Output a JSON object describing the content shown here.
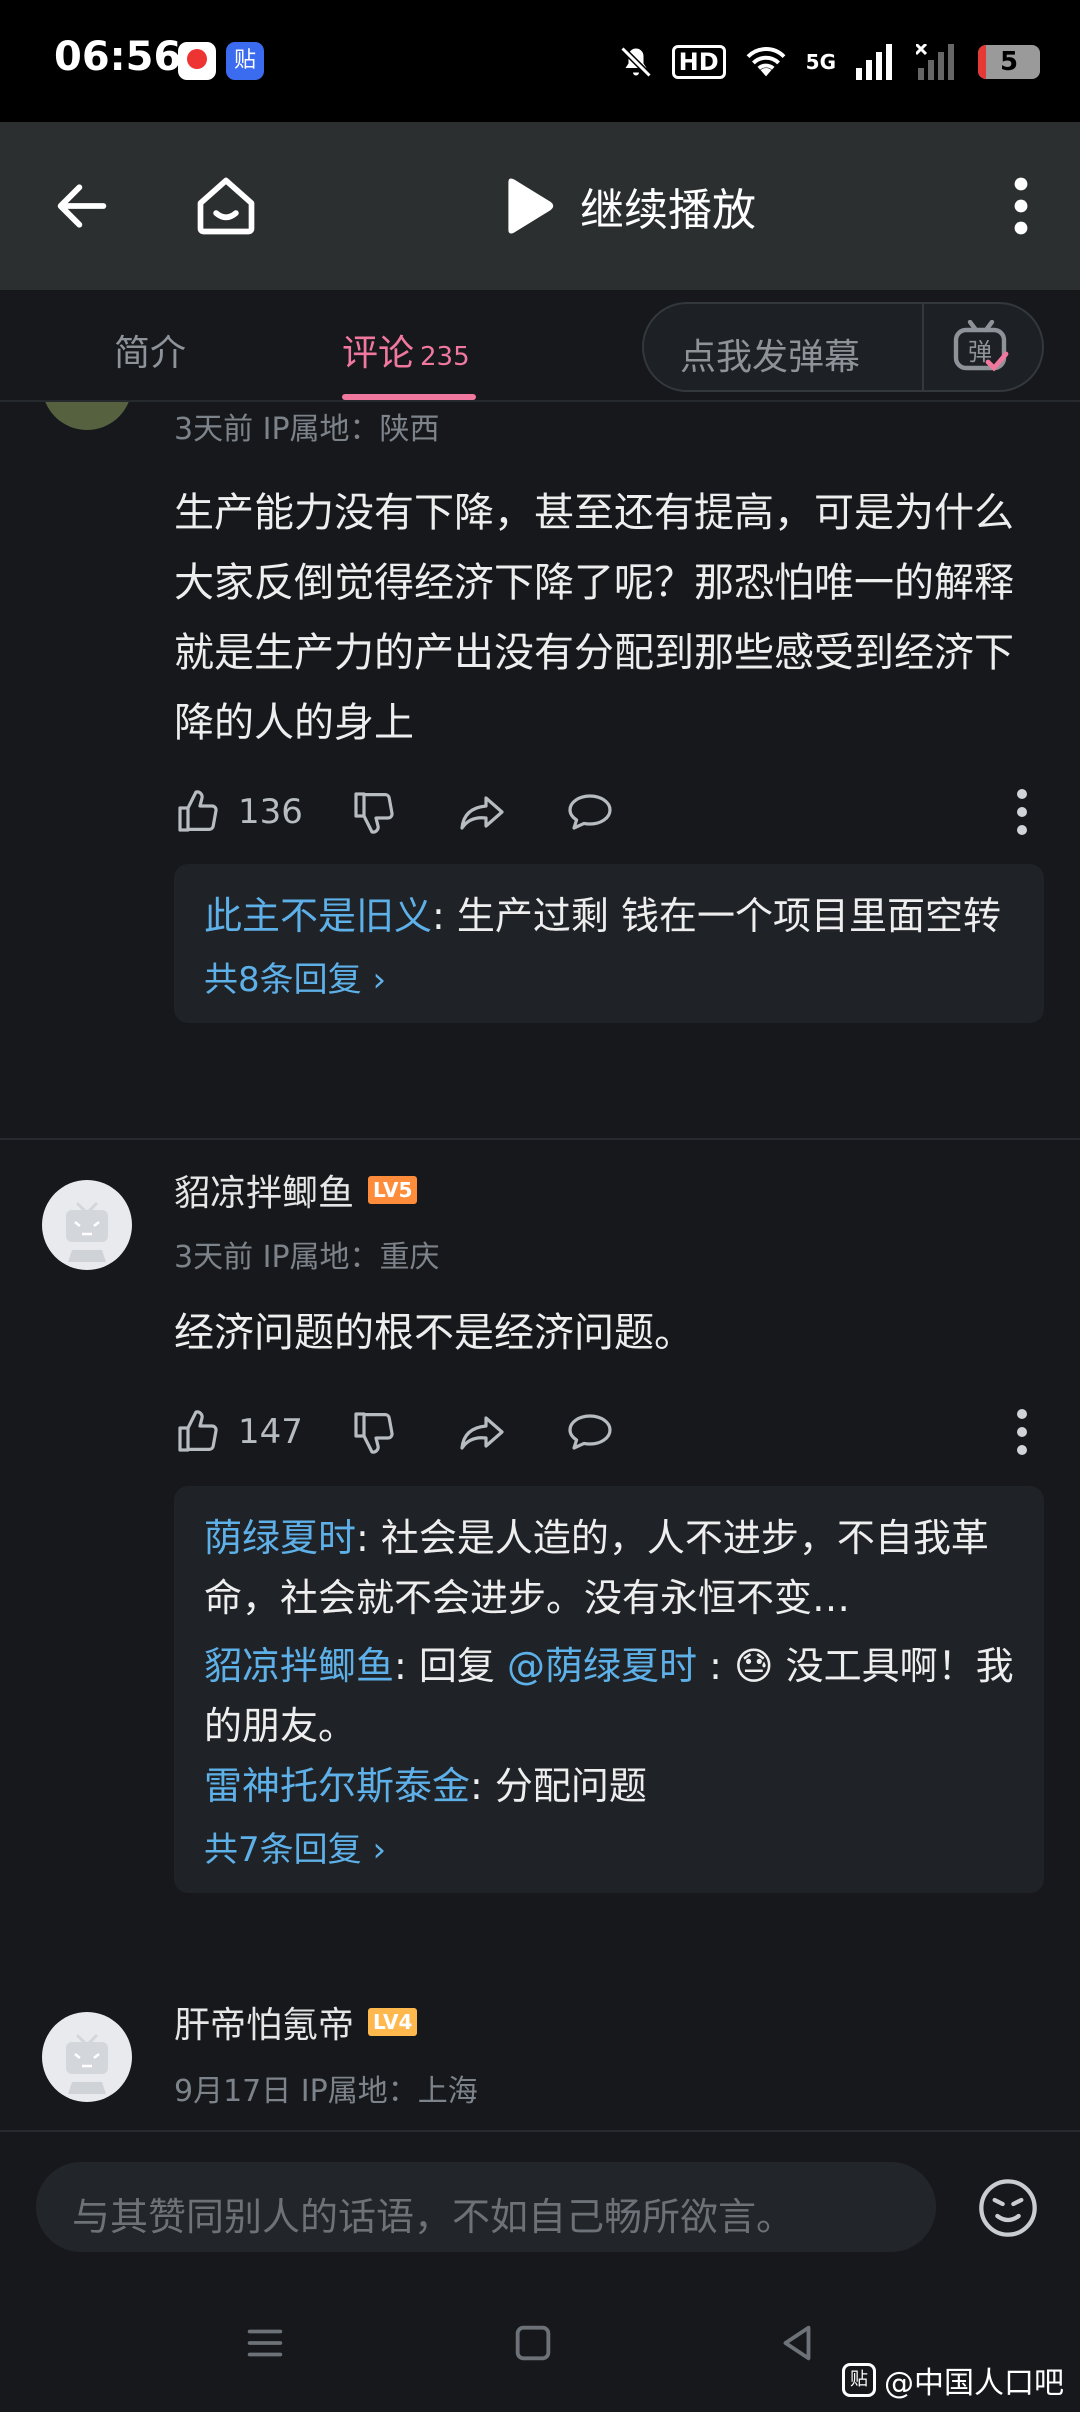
{
  "status_bar": {
    "time": "06:56",
    "app_icon_2": "贴",
    "hd_label": "HD",
    "network_label": "5G",
    "battery_level": "5"
  },
  "top_bar": {
    "resume_label": "继续播放"
  },
  "tabs": {
    "intro": "简介",
    "comments": "评论",
    "comments_count": "235",
    "danmu_placeholder": "点我发弹幕",
    "danmu_icon_text": "弹"
  },
  "comments": [
    {
      "meta": "3天前  IP属地：陕西",
      "text": "生产能力没有下降，甚至还有提高，可是为什么大家反倒觉得经济下降了呢？那恐怕唯一的解释就是生产力的产出没有分配到那些感受到经济下降的人的身上",
      "likes": "136",
      "replies": [
        {
          "user": "此主不是旧义",
          "text": ": 生产过剩 钱在一个项目里面空转"
        }
      ],
      "more_replies": "共8条回复 ›"
    },
    {
      "user": "貂凉拌鲫鱼",
      "level": "LV5",
      "meta": "3天前  IP属地：重庆",
      "text": "经济问题的根不是经济问题。",
      "likes": "147",
      "replies": [
        {
          "user": "荫绿夏时",
          "text": ": 社会是人造的，人不进步，不自我革命，社会就不会进步。没有永恒不变…"
        },
        {
          "user": "貂凉拌鲫鱼",
          "text_pre": ": 回复 ",
          "mention": "@荫绿夏时",
          "text": " : 😓 没工具啊！我的朋友。"
        },
        {
          "user": "雷神托尔斯泰金",
          "text": ": 分配问题"
        }
      ],
      "more_replies": "共7条回复 ›"
    },
    {
      "user": "肝帝怕氪帝",
      "level": "LV4",
      "meta": "9月17日  IP属地：上海"
    }
  ],
  "input": {
    "placeholder": "与其赞同别人的话语，不如自己畅所欲言。"
  },
  "watermark": {
    "badge": "贴",
    "text": "@中国人口吧"
  }
}
